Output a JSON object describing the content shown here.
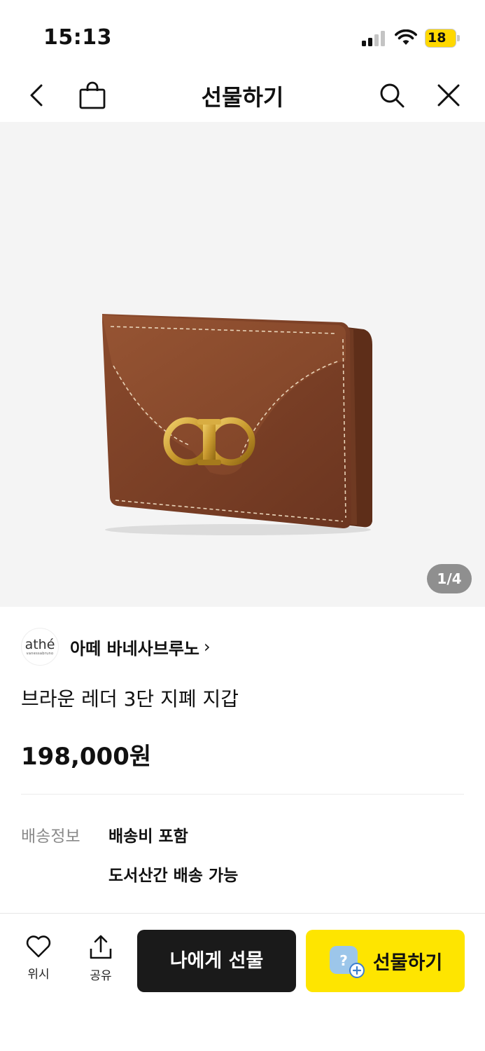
{
  "status_bar": {
    "time": "15:13",
    "battery_level": "18"
  },
  "nav": {
    "title": "선물하기",
    "icons": [
      "back-icon",
      "shopping-bag-icon",
      "search-icon",
      "close-icon"
    ]
  },
  "product": {
    "image_indicator": "1/4",
    "brand_logo_text": "athé",
    "brand_logo_subtext": "vanessabruno",
    "brand_name": "아떼 바네사브루노",
    "brand_chevron": "›",
    "name": "브라운 레더 3단 지폐 지갑",
    "price": "198,000원"
  },
  "shipping": {
    "label": "배송정보",
    "line1": "배송비 포함",
    "line2": "도서산간 배송 가능"
  },
  "bottom_bar": {
    "wish_label": "위시",
    "share_label": "공유",
    "self_gift_label": "나에게 선물",
    "gift_label": "선물하기",
    "gift_badge_symbol": "?"
  },
  "colors": {
    "accent_yellow": "#fee500",
    "dark_button": "#1a1a1a",
    "image_background": "#f4f4f4"
  }
}
